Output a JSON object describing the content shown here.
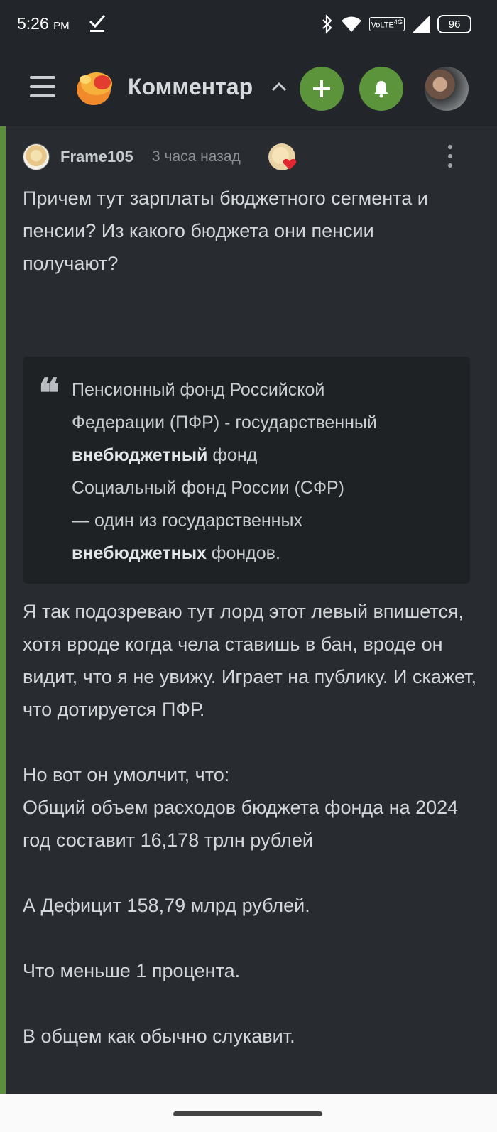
{
  "status_bar": {
    "time": "5:26",
    "ampm": "PM",
    "battery": "96",
    "network": "VoLTE",
    "network_gen": "4G"
  },
  "header": {
    "title": "Комментарии",
    "accent": "#5c943c"
  },
  "comment": {
    "author": "Frame105",
    "time": "3 часа назад",
    "paragraph_1": "Причем тут зарплаты бюджетного сегмента и пенсии? Из какого бюджета они пенсии получают?",
    "quote": {
      "line1": "Пенсионный фонд Российской",
      "line2": "Федерации (ПФР) - государственный",
      "line3_bold": "внебюджетный",
      "line3_rest": " фонд",
      "line4": "Социальный фонд России (СФР)",
      "line5": "— один из государственных",
      "line6_bold": "внебюджетных",
      "line6_rest": " фондов."
    },
    "paragraph_2": "Я так подозреваю тут лорд этот левый впишется, хотя вроде когда чела ставишь в бан, вроде он видит, что я не увижу. Играет на публику. И скажет, что дотируется ПФР.",
    "paragraph_3": "Но вот он умолчит, что:",
    "paragraph_4": "Общий объем расходов бюджета фонда на 2024 год составит 16,178 трлн рублей",
    "paragraph_5": "А Дефицит 158,79 млрд рублей.",
    "paragraph_6": "Что меньше 1 процента.",
    "paragraph_7": "В общем как обычно слукавит."
  }
}
